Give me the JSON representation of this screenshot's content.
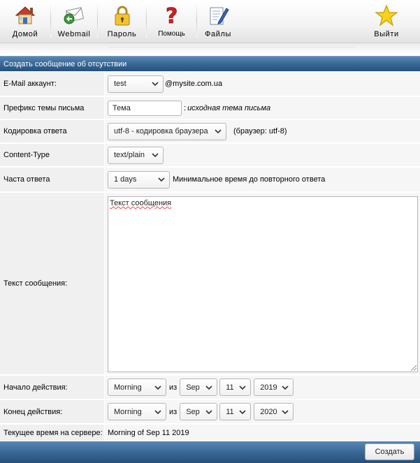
{
  "toolbar": {
    "items": [
      {
        "label": "Домой",
        "icon": "home-icon"
      },
      {
        "label": "Webmail",
        "icon": "webmail-icon"
      },
      {
        "label": "Пароль",
        "icon": "lock-icon"
      },
      {
        "label": "Помощь",
        "icon": "help-icon"
      },
      {
        "label": "Файлы",
        "icon": "files-icon"
      },
      {
        "label": "Выйти",
        "icon": "star-icon"
      }
    ]
  },
  "header": {
    "title": "Создать сообщение об отсутствии"
  },
  "form": {
    "account": {
      "label": "E-Mail аккаунт:",
      "value": "test",
      "domain": "@mysite.com.ua"
    },
    "subject_prefix": {
      "label": "Префикс темы письма",
      "value": "Тема",
      "note_sep": ":",
      "note": "исходная тема письма"
    },
    "encoding": {
      "label": "Кодировка ответа",
      "value": "utf-8 - кодировка браузера",
      "note": "(браузер: utf-8)"
    },
    "content_type": {
      "label": "Content-Type",
      "value": "text/plain"
    },
    "frequency": {
      "label": "Часта ответа",
      "value": "1 days",
      "note": "Минимальное время до повторного ответа"
    },
    "message": {
      "label": "Текст сообщения:",
      "value": "Текст сообщения"
    },
    "start": {
      "label": "Начало действия:",
      "time": "Morning",
      "sep": "из",
      "month": "Sep",
      "day": "11",
      "year": "2019"
    },
    "end": {
      "label": "Конец действия:",
      "time": "Morning",
      "sep": "из",
      "month": "Sep",
      "day": "11",
      "year": "2020"
    },
    "server_time": {
      "label": "Текущее время на сервере:",
      "value": "Morning of Sep 11 2019"
    }
  },
  "footer": {
    "submit_label": "Создать"
  },
  "colors": {
    "header_blue": "#3b6b99",
    "label_bg": "#f0f0f0",
    "value_bg": "#f6f6f6"
  }
}
